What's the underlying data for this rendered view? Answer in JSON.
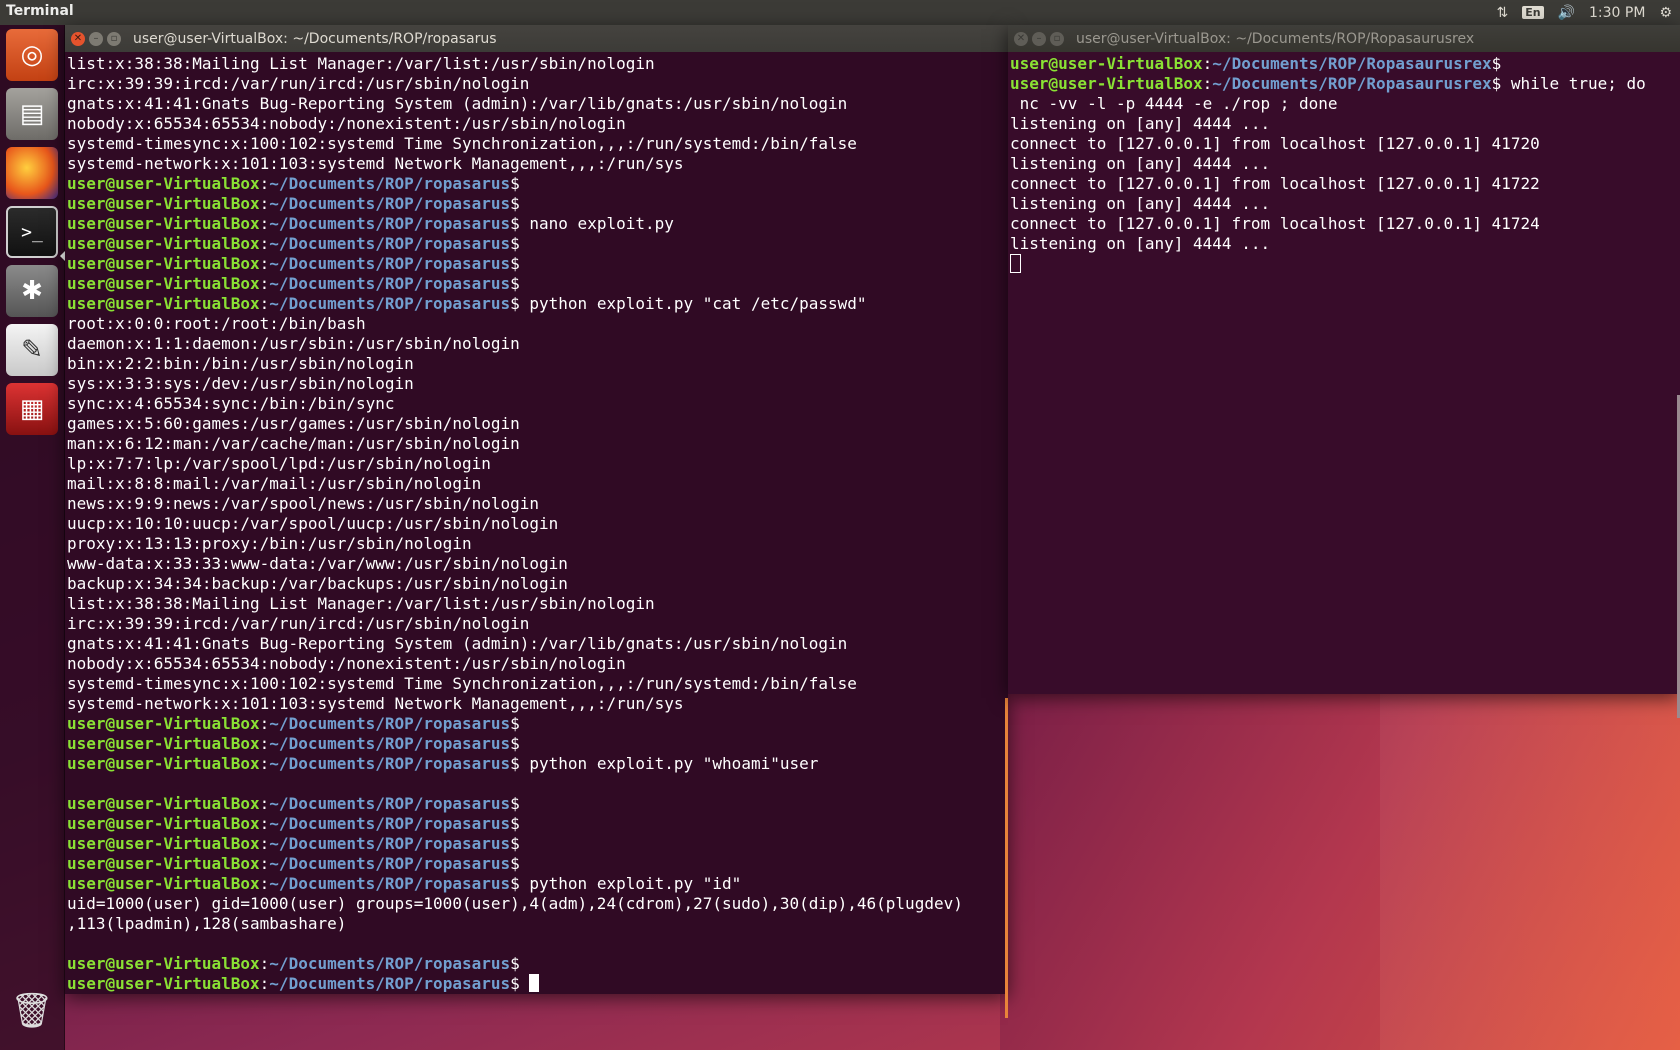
{
  "panel": {
    "app_title": "Terminal",
    "keyboard": "En",
    "clock": "1:30 PM",
    "network_icon": "network-updown-icon",
    "volume_icon": "volume-icon",
    "settings_icon": "gear-icon"
  },
  "launcher": {
    "items": [
      "ubuntu-logo-icon",
      "files-icon",
      "firefox-icon",
      "terminal-icon",
      "system-settings-icon",
      "text-editor-icon",
      "remote-desktop-icon",
      "trash-icon"
    ]
  },
  "window1": {
    "title": "user@user-VirtualBox: ~/Documents/ROP/ropasarus",
    "prompt_user": "user@user-VirtualBox",
    "prompt_path": "~/Documents/ROP/ropasarus",
    "lines": [
      {
        "t": "o",
        "text": "list:x:38:38:Mailing List Manager:/var/list:/usr/sbin/nologin"
      },
      {
        "t": "o",
        "text": "irc:x:39:39:ircd:/var/run/ircd:/usr/sbin/nologin"
      },
      {
        "t": "o",
        "text": "gnats:x:41:41:Gnats Bug-Reporting System (admin):/var/lib/gnats:/usr/sbin/nologin"
      },
      {
        "t": "o",
        "text": "nobody:x:65534:65534:nobody:/nonexistent:/usr/sbin/nologin"
      },
      {
        "t": "o",
        "text": "systemd-timesync:x:100:102:systemd Time Synchronization,,,:/run/systemd:/bin/false"
      },
      {
        "t": "o",
        "text": "systemd-network:x:101:103:systemd Network Management,,,:/run/sys"
      },
      {
        "t": "p",
        "cmd": ""
      },
      {
        "t": "p",
        "cmd": ""
      },
      {
        "t": "p",
        "cmd": " nano exploit.py"
      },
      {
        "t": "p",
        "cmd": ""
      },
      {
        "t": "p",
        "cmd": ""
      },
      {
        "t": "p",
        "cmd": ""
      },
      {
        "t": "p",
        "cmd": " python exploit.py \"cat /etc/passwd\""
      },
      {
        "t": "o",
        "text": "root:x:0:0:root:/root:/bin/bash"
      },
      {
        "t": "o",
        "text": "daemon:x:1:1:daemon:/usr/sbin:/usr/sbin/nologin"
      },
      {
        "t": "o",
        "text": "bin:x:2:2:bin:/bin:/usr/sbin/nologin"
      },
      {
        "t": "o",
        "text": "sys:x:3:3:sys:/dev:/usr/sbin/nologin"
      },
      {
        "t": "o",
        "text": "sync:x:4:65534:sync:/bin:/bin/sync"
      },
      {
        "t": "o",
        "text": "games:x:5:60:games:/usr/games:/usr/sbin/nologin"
      },
      {
        "t": "o",
        "text": "man:x:6:12:man:/var/cache/man:/usr/sbin/nologin"
      },
      {
        "t": "o",
        "text": "lp:x:7:7:lp:/var/spool/lpd:/usr/sbin/nologin"
      },
      {
        "t": "o",
        "text": "mail:x:8:8:mail:/var/mail:/usr/sbin/nologin"
      },
      {
        "t": "o",
        "text": "news:x:9:9:news:/var/spool/news:/usr/sbin/nologin"
      },
      {
        "t": "o",
        "text": "uucp:x:10:10:uucp:/var/spool/uucp:/usr/sbin/nologin"
      },
      {
        "t": "o",
        "text": "proxy:x:13:13:proxy:/bin:/usr/sbin/nologin"
      },
      {
        "t": "o",
        "text": "www-data:x:33:33:www-data:/var/www:/usr/sbin/nologin"
      },
      {
        "t": "o",
        "text": "backup:x:34:34:backup:/var/backups:/usr/sbin/nologin"
      },
      {
        "t": "o",
        "text": "list:x:38:38:Mailing List Manager:/var/list:/usr/sbin/nologin"
      },
      {
        "t": "o",
        "text": "irc:x:39:39:ircd:/var/run/ircd:/usr/sbin/nologin"
      },
      {
        "t": "o",
        "text": "gnats:x:41:41:Gnats Bug-Reporting System (admin):/var/lib/gnats:/usr/sbin/nologin"
      },
      {
        "t": "o",
        "text": "nobody:x:65534:65534:nobody:/nonexistent:/usr/sbin/nologin"
      },
      {
        "t": "o",
        "text": "systemd-timesync:x:100:102:systemd Time Synchronization,,,:/run/systemd:/bin/false"
      },
      {
        "t": "o",
        "text": "systemd-network:x:101:103:systemd Network Management,,,:/run/sys"
      },
      {
        "t": "p",
        "cmd": ""
      },
      {
        "t": "p",
        "cmd": ""
      },
      {
        "t": "p",
        "cmd": " python exploit.py \"whoami\"user"
      },
      {
        "t": "o",
        "text": ""
      },
      {
        "t": "p",
        "cmd": ""
      },
      {
        "t": "p",
        "cmd": ""
      },
      {
        "t": "p",
        "cmd": ""
      },
      {
        "t": "p",
        "cmd": ""
      },
      {
        "t": "p",
        "cmd": " python exploit.py \"id\""
      },
      {
        "t": "o",
        "text": "uid=1000(user) gid=1000(user) groups=1000(user),4(adm),24(cdrom),27(sudo),30(dip),46(plugdev)"
      },
      {
        "t": "o",
        "text": ",113(lpadmin),128(sambashare)"
      },
      {
        "t": "o",
        "text": ""
      },
      {
        "t": "p",
        "cmd": ""
      },
      {
        "t": "p",
        "cmd": " ",
        "cursor": true
      }
    ]
  },
  "window2": {
    "title": "user@user-VirtualBox: ~/Documents/ROP/Ropasaurusrex",
    "prompt_user": "user@user-VirtualBox",
    "prompt_path": "~/Documents/ROP/Ropasaurusrex",
    "lines": [
      {
        "t": "p",
        "cmd": ""
      },
      {
        "t": "p",
        "cmd": " while true; do"
      },
      {
        "t": "o",
        "text": " nc -vv -l -p 4444 -e ./rop ; done"
      },
      {
        "t": "o",
        "text": "listening on [any] 4444 ..."
      },
      {
        "t": "o",
        "text": "connect to [127.0.0.1] from localhost [127.0.0.1] 41720"
      },
      {
        "t": "o",
        "text": "listening on [any] 4444 ..."
      },
      {
        "t": "o",
        "text": "connect to [127.0.0.1] from localhost [127.0.0.1] 41722"
      },
      {
        "t": "o",
        "text": "listening on [any] 4444 ..."
      },
      {
        "t": "o",
        "text": "connect to [127.0.0.1] from localhost [127.0.0.1] 41724"
      },
      {
        "t": "o",
        "text": "listening on [any] 4444 ..."
      },
      {
        "t": "o",
        "text": "",
        "cursor": "hollow"
      }
    ]
  }
}
